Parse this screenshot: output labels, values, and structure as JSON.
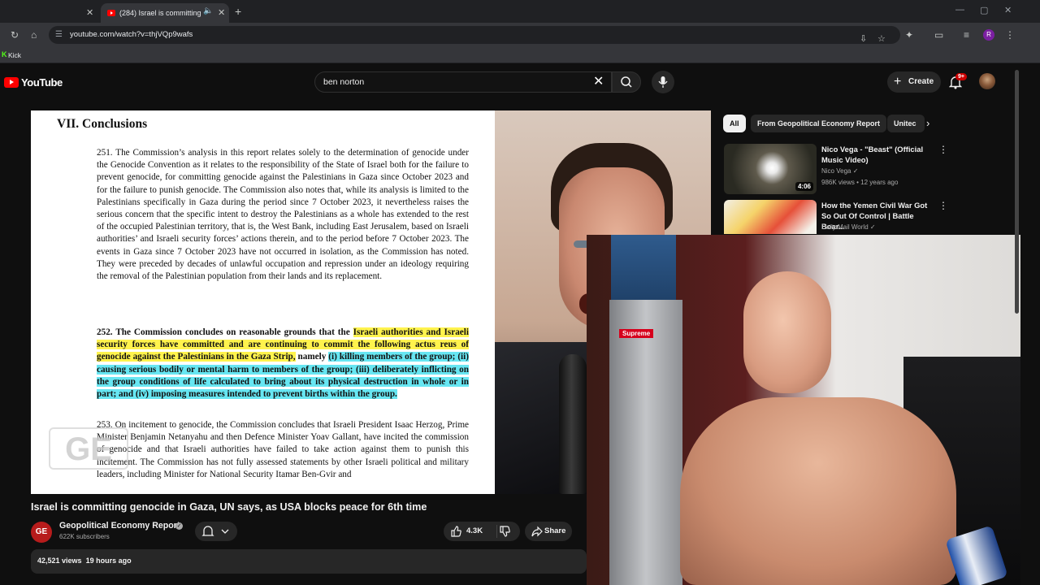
{
  "browser": {
    "tabs": [
      {
        "label": ""
      },
      {
        "label": "(284) Israel is committing g"
      }
    ],
    "url": "youtube.com/watch?v=thjVQp9wafs",
    "bookmarks": [
      {
        "label": "Kick"
      }
    ],
    "profile_initial": "R"
  },
  "youtube": {
    "logo_text": "YouTube",
    "search_value": "ben norton",
    "create_label": "Create",
    "notification_badge": "9+"
  },
  "document": {
    "heading": "VII.   Conclusions",
    "para1": "251.   The Commission’s analysis in this report relates solely to the determination of genocide under the Genocide Convention as it relates to the responsibility of the State of Israel both for the failure to prevent genocide, for committing genocide against the Palestinians in Gaza since October 2023 and for the failure to punish genocide. The Commission also notes that, while its analysis is limited to the Palestinians specifically in Gaza during the period since 7 October 2023, it nevertheless raises the serious concern that the specific intent to destroy the Palestinians as a whole has extended to the rest of the occupied Palestinian territory, that is, the West Bank, including East Jerusalem, based on Israeli authorities’ and Israeli security forces’ actions therein, and to the period before 7 October 2023. The events in Gaza since 7 October 2023 have not occurred in isolation, as the Commission has noted. They were preceded by decades of unlawful occupation and repression under an ideology requiring the removal of the Palestinian population from their lands and its replacement.",
    "para2_a": "252.   The Commission concludes on reasonable grounds that the ",
    "para2_b": "Israeli authorities and Israeli security forces have committed and are continuing to commit the following actus reus of genocide against the Palestinians in the Gaza Strip,",
    "para2_c": " namely ",
    "para2_d": "(i) killing members of the group; (ii) causing serious bodily or mental harm to members of the group; (iii) deliberately inflicting on the group conditions of life calculated to bring about its physical destruction in whole or in part; and (iv) imposing measures intended to prevent births within the group.",
    "para3": "253.   On incitement to genocide, the Commission concludes that Israeli President Isaac Herzog, Prime Minister Benjamin Netanyahu and then Defence Minister Yoav Gallant, have incited the commission of genocide and that Israeli authorities have failed to take action against them to punish this incitement. The Commission has not fully assessed statements by other Israeli political and military leaders, including Minister for National Security Itamar Ben-Gvir and",
    "watermark": "GE"
  },
  "video": {
    "title": "Israel is committing genocide in Gaza, UN says, as USA blocks peace for 6th time",
    "channel_name": "Geopolitical Economy Report",
    "channel_avatar": "GE",
    "subscribers": "622K subscribers",
    "likes": "4.3K",
    "share_label": "Share",
    "views": "42,521 views",
    "age": "19 hours ago"
  },
  "sidebar": {
    "chips": [
      "All",
      "From Geopolitical Economy Report",
      "Unitec"
    ],
    "recommendations": [
      {
        "title": "Nico Vega - \"Beast\" (Official Music Video)",
        "channel": "Nico Vega",
        "views": "986K views",
        "age": "12 years ago",
        "duration": "4:06"
      },
      {
        "title": "How the Yemen Civil War Got So Out Of Control | Battle Boar...",
        "channel": "Daily Mail World",
        "views": "",
        "age": "",
        "duration": ""
      }
    ]
  },
  "webcam": {
    "sticker_text": "Supreme"
  },
  "colors": {
    "background": "#0f0f0f",
    "brand_red": "#ff0000",
    "highlight_yellow": "#fff34d",
    "highlight_cyan": "#67e6f2"
  },
  "icons": [
    "close-icon",
    "mute-icon",
    "new-tab-icon",
    "minimize-icon",
    "maximize-icon",
    "reload-icon",
    "home-icon",
    "site-info-icon",
    "install-icon",
    "bookmark-star-icon",
    "extensions-icon",
    "search-icon",
    "mic-icon",
    "plus-icon",
    "bell-icon",
    "verified-icon",
    "chevron-down-icon",
    "thumbs-up-icon",
    "thumbs-down-icon",
    "share-icon",
    "chevron-right-icon",
    "more-vert-icon"
  ]
}
